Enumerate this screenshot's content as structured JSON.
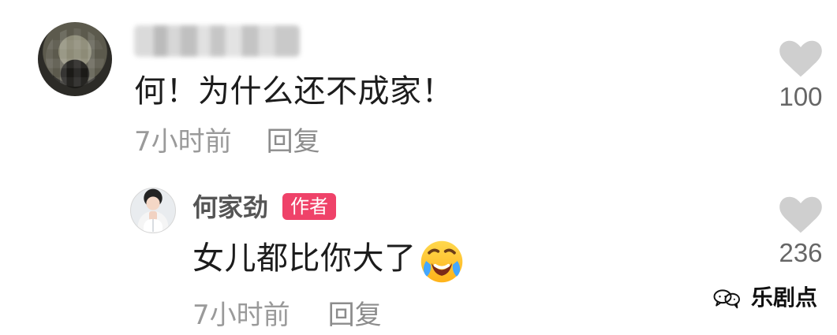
{
  "comment": {
    "text": "何！为什么还不成家！",
    "time": "7小时前",
    "reply_label": "回复",
    "likes": "100"
  },
  "reply": {
    "username": "何家劲",
    "badge": "作者",
    "text": "女儿都比你大了",
    "time": "7小时前",
    "reply_label": "回复",
    "likes": "236"
  },
  "watermark": {
    "text": "乐剧点"
  },
  "icons": {
    "heart": "heart-icon",
    "emoji": "laughing-crying-emoji",
    "wechat": "wechat-icon"
  },
  "colors": {
    "badge": "#ef4269",
    "heart": "#cfcfcf",
    "meta": "#9a9a9a"
  }
}
